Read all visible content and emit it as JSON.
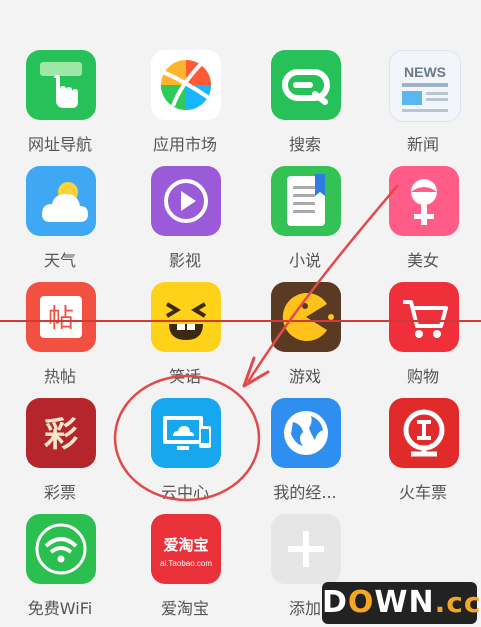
{
  "apps": [
    {
      "label": "网址导航",
      "icon": "hand-pointer-icon",
      "color": "#27c15a"
    },
    {
      "label": "应用市场",
      "icon": "app-market-ball-icon",
      "color": "#ffffff"
    },
    {
      "label": "搜索",
      "icon": "search-icon",
      "color": "#27c15a"
    },
    {
      "label": "新闻",
      "icon": "news-icon",
      "color": "#e9f2fb",
      "badge": "NEWS"
    },
    {
      "label": "天气",
      "icon": "weather-cloud-sun-icon",
      "color": "#3fa8f4"
    },
    {
      "label": "影视",
      "icon": "play-icon",
      "color": "#9b5ad8"
    },
    {
      "label": "小说",
      "icon": "book-icon",
      "color": "#34c255"
    },
    {
      "label": "美女",
      "icon": "female-face-icon",
      "color": "#ff5d87"
    },
    {
      "label": "热帖",
      "icon": "hot-post-icon",
      "color": "#f25041",
      "badge": "帖"
    },
    {
      "label": "笑话",
      "icon": "laugh-face-icon",
      "color": "#ffd21a"
    },
    {
      "label": "游戏",
      "icon": "pacman-icon",
      "color": "#5a3a22"
    },
    {
      "label": "购物",
      "icon": "shopping-cart-icon",
      "color": "#ef2f3a"
    },
    {
      "label": "彩票",
      "icon": "lottery-icon",
      "color": "#b5262c",
      "badge": "彩"
    },
    {
      "label": "云中心",
      "icon": "cloud-devices-icon",
      "color": "#16a7ef"
    },
    {
      "label": "我的经...",
      "icon": "globe-icon",
      "color": "#2f8ff0"
    },
    {
      "label": "火车票",
      "icon": "railway-icon",
      "color": "#e12a2a"
    },
    {
      "label": "免费WiFi",
      "icon": "wifi-icon",
      "color": "#2bbf4f"
    },
    {
      "label": "爱淘宝",
      "icon": "taobao-icon",
      "color": "#e9313a",
      "badge": "爱淘宝",
      "sub": "ai.Taobao.com"
    },
    {
      "label": "添加",
      "icon": "add-icon",
      "color": "#e6e6e6"
    }
  ],
  "watermark": {
    "text1": "D",
    "text2": "O",
    "text3": "WN",
    "text4": ".cc"
  }
}
